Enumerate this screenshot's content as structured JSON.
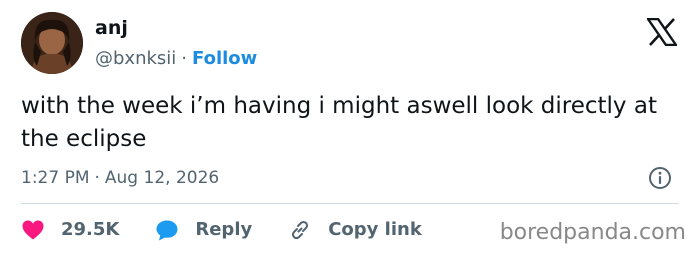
{
  "author": {
    "name": "anj",
    "handle": "@bxnksii",
    "separator": "·",
    "follow_label": "Follow"
  },
  "platform_icon": "x-logo-icon",
  "tweet": {
    "text": "with the week i’m having i might aswell look directly at the eclipse",
    "time": "1:27 PM",
    "date": "Aug 12, 2026",
    "separator": "·"
  },
  "actions": {
    "like_count": "29.5K",
    "reply_label": "Reply",
    "copy_link_label": "Copy link"
  },
  "watermark": "boredpanda.com",
  "colors": {
    "accent": "#1d8ce0",
    "like": "#f91880",
    "reply": "#1d9bf0",
    "muted": "#536471",
    "text": "#0f1419"
  }
}
